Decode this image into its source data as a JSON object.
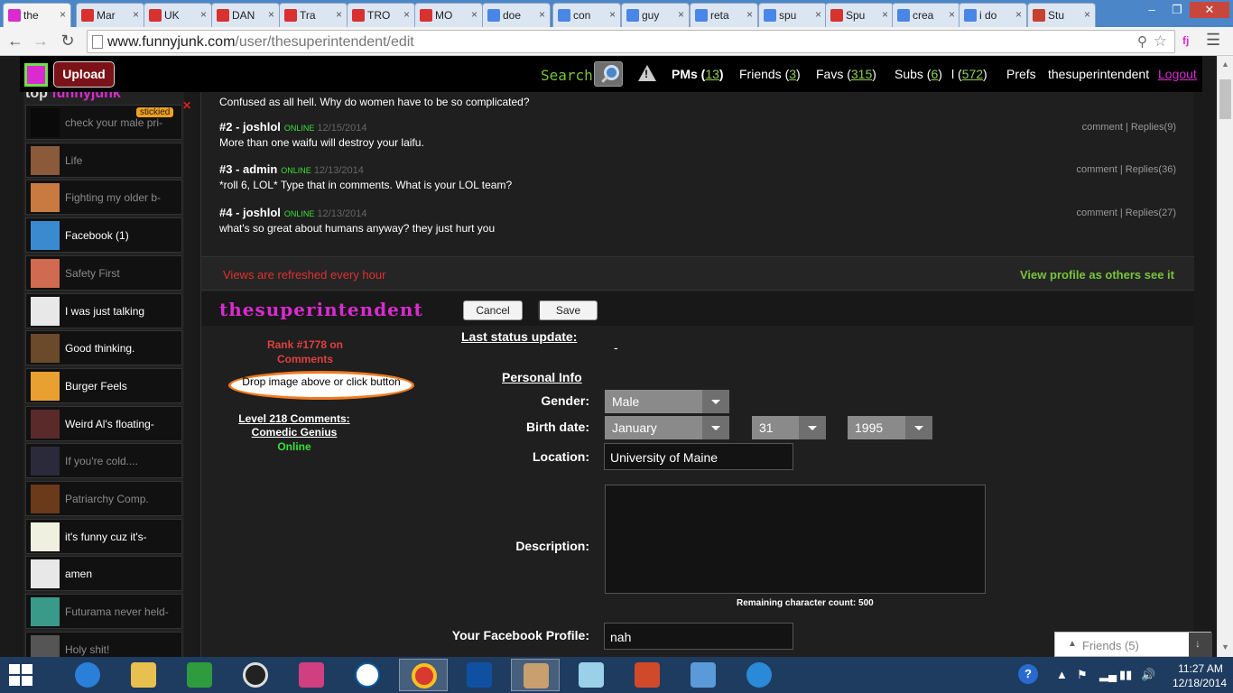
{
  "browser": {
    "tabs": [
      {
        "title": "the",
        "favicon_color": "#d92bcf"
      },
      {
        "title": "Mar",
        "favicon_color": "#d93030"
      },
      {
        "title": "UK",
        "favicon_color": "#d93030"
      },
      {
        "title": "DAN",
        "favicon_color": "#d93030"
      },
      {
        "title": "Tra",
        "favicon_color": "#d93030"
      },
      {
        "title": "TRO",
        "favicon_color": "#d93030"
      },
      {
        "title": "MO",
        "favicon_color": "#d93030"
      },
      {
        "title": "doe",
        "favicon_color": "#4a86e8"
      },
      {
        "title": "con",
        "favicon_color": "#4a86e8"
      },
      {
        "title": "guy",
        "favicon_color": "#4a86e8"
      },
      {
        "title": "reta",
        "favicon_color": "#4a86e8"
      },
      {
        "title": "spu",
        "favicon_color": "#4a86e8"
      },
      {
        "title": "Spu",
        "favicon_color": "#d93030"
      },
      {
        "title": "crea",
        "favicon_color": "#4a86e8"
      },
      {
        "title": "i do",
        "favicon_color": "#4a86e8"
      },
      {
        "title": "Stu",
        "favicon_color": "#c84030"
      }
    ],
    "url_domain": "www.funnyjunk.com",
    "url_path": "/user/thesuperintendent/edit"
  },
  "topbar": {
    "upload_label": "Upload",
    "search_label": "Search",
    "pms_label": "PMs (",
    "pms_count": "13",
    "friends_label": "Friends (",
    "friends_count": "3",
    "favs_label": "Favs (",
    "favs_count": "315",
    "subs_label": "Subs (",
    "subs_count": "6",
    "l_label": "l (",
    "l_count": "572",
    "close_paren": ")",
    "prefs_label": "Prefs",
    "username_label": "thesuperintendent",
    "logout_label": "Logout"
  },
  "sidebar": {
    "header_prefix": "top ",
    "header_highlight": "funnyjunk",
    "stickied_label": "stickied",
    "items": [
      {
        "label": "check your male pri-",
        "style": "dim",
        "thumb_color": "#0a0a0a"
      },
      {
        "label": "Life",
        "style": "dim",
        "thumb_color": "#8a5a3a"
      },
      {
        "label": "Fighting my older b-",
        "style": "dim",
        "thumb_color": "#c87a40"
      },
      {
        "label": "Facebook (1)",
        "style": "bright",
        "thumb_color": "#3a8ad0"
      },
      {
        "label": "Safety First",
        "style": "dim",
        "thumb_color": "#d06a50"
      },
      {
        "label": "I was just talking",
        "style": "bright",
        "thumb_color": "#e8e8e8"
      },
      {
        "label": "Good thinking.",
        "style": "bright",
        "thumb_color": "#6a4a2a"
      },
      {
        "label": "Burger Feels",
        "style": "bright",
        "thumb_color": "#e8a030"
      },
      {
        "label": "Weird Al's floating-",
        "style": "bright",
        "thumb_color": "#5a2a2a"
      },
      {
        "label": "If you're cold....",
        "style": "dim",
        "thumb_color": "#2a2a3a"
      },
      {
        "label": "Patriarchy Comp.",
        "style": "dim",
        "thumb_color": "#6a3a1a"
      },
      {
        "label": "it's funny cuz it's-",
        "style": "bright",
        "thumb_color": "#f0f0e0"
      },
      {
        "label": "amen",
        "style": "bright",
        "thumb_color": "#e8e8e8"
      },
      {
        "label": "Futurama never held-",
        "style": "dim",
        "thumb_color": "#3a9a8a"
      },
      {
        "label": "Holy shit!",
        "style": "dim",
        "thumb_color": "#555555"
      }
    ]
  },
  "comments": {
    "partial_body": "Confused as all hell. Why do women have to be so complicated?",
    "items": [
      {
        "head": "#2 - joshlol",
        "online": "ONLINE",
        "date": "12/15/2014",
        "body": "More than one waifu will destroy your laifu.",
        "actions": "comment  | Replies(9)"
      },
      {
        "head": "#3 - admin",
        "online": "ONLINE",
        "date": "12/13/2014",
        "body": "*roll 6, LOL* Type that in comments. What is your LOL team?",
        "actions": "comment  | Replies(36)"
      },
      {
        "head": "#4 - joshlol",
        "online": "ONLINE",
        "date": "12/13/2014",
        "body": "what's so great about humans anyway? they just hurt you",
        "actions": "comment  | Replies(27)"
      }
    ]
  },
  "refresh_note": "Views are refreshed every hour",
  "view_as_others": "View profile as others see it",
  "profile": {
    "username": "thesuperintendent",
    "cancel_label": "Cancel",
    "save_label": "Save",
    "rank_line1": "Rank #1778 on",
    "rank_line2": "Comments",
    "drop_text": "Drop image above or click button",
    "level_line1": "Level 218 Comments:",
    "level_line2": "Comedic Genius",
    "online_status": "Online",
    "last_status_label": "Last status update:",
    "last_status_value": "-",
    "personal_info_label": "Personal Info",
    "gender_label": "Gender:",
    "gender_value": "Male",
    "birth_label": "Birth date:",
    "birth_month": "January",
    "birth_day": "31",
    "birth_year": "1995",
    "location_label": "Location:",
    "location_value": "University of Maine",
    "description_label": "Description:",
    "char_count": "Remaining character count: 500",
    "facebook_label": "Your Facebook Profile:",
    "facebook_value": "nah"
  },
  "friends_bar": {
    "label": "Friends (5)"
  },
  "taskbar": {
    "time": "11:27 AM",
    "date": "12/18/2014"
  }
}
